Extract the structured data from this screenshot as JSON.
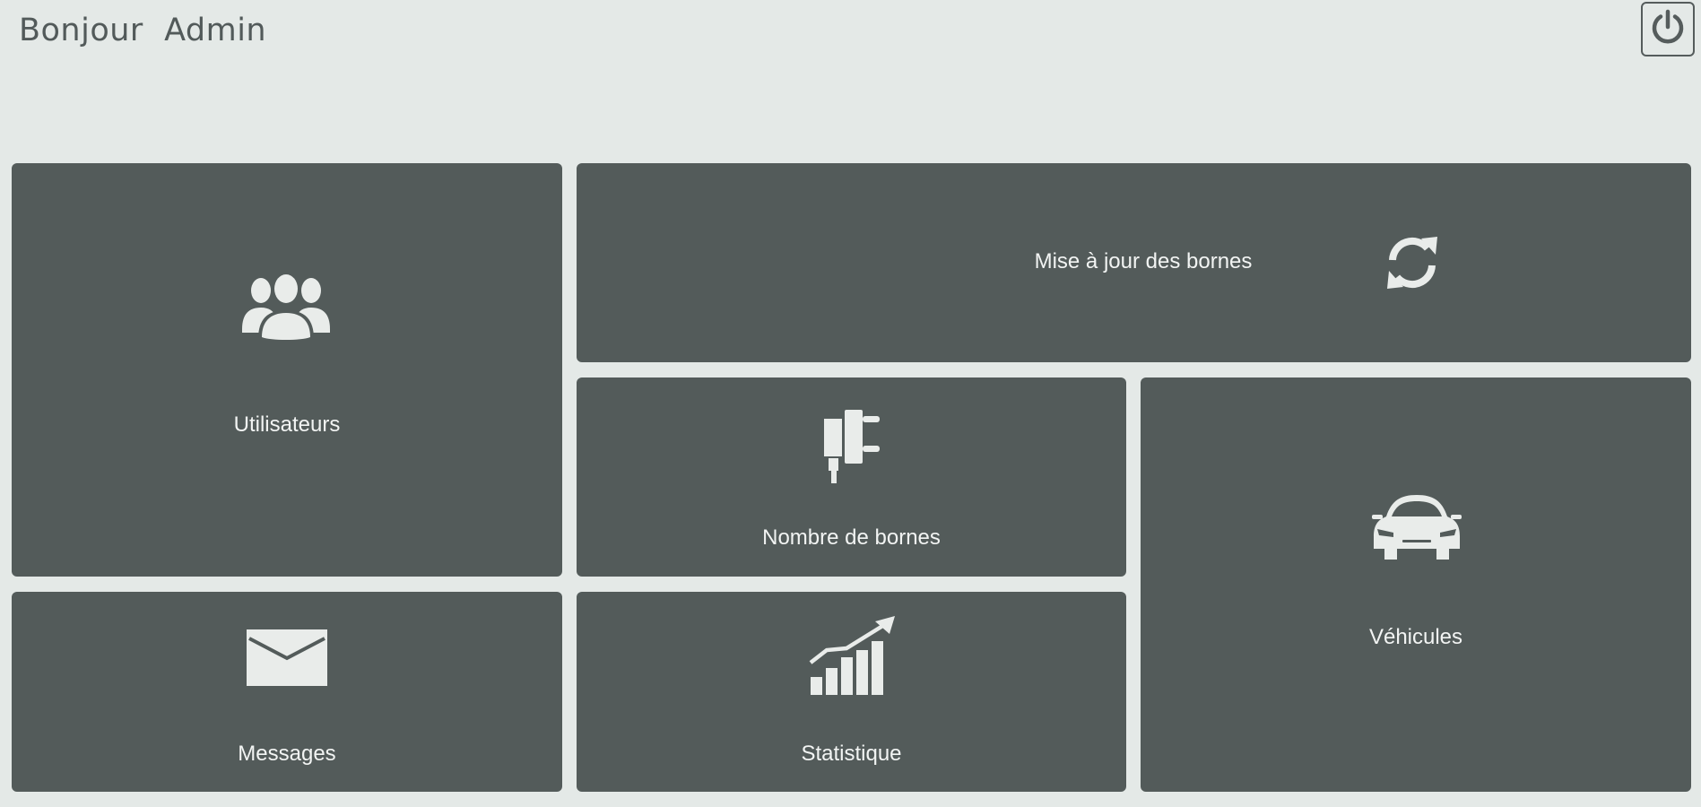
{
  "header": {
    "greeting": "Bonjour  Admin"
  },
  "toolbar": {
    "logout_icon": "power-icon"
  },
  "tiles": {
    "users": {
      "label": "Utilisateurs",
      "icon": "users-icon"
    },
    "update": {
      "label": "Mise à jour des bornes",
      "icon": "refresh-icon"
    },
    "bornes": {
      "label": "Nombre de bornes",
      "icon": "charger-plug-icon"
    },
    "vehicles": {
      "label": "Véhicules",
      "icon": "car-icon"
    },
    "messages": {
      "label": "Messages",
      "icon": "envelope-icon"
    },
    "stats": {
      "label": "Statistique",
      "icon": "growth-chart-icon"
    }
  },
  "colors": {
    "background": "#e4e9e7",
    "tile": "#535b5a",
    "tile_text": "#f2f4f3",
    "header_text": "#525a5a"
  }
}
